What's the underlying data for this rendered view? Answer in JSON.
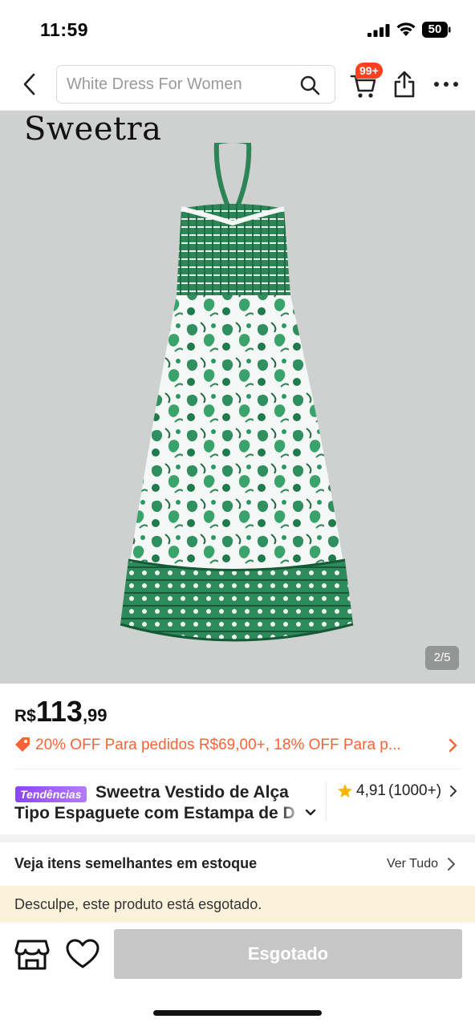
{
  "status_bar": {
    "time": "11:59",
    "battery": "50"
  },
  "nav": {
    "search_placeholder": "White Dress For Women",
    "cart_badge": "99+"
  },
  "hero": {
    "brand": "Sweetra",
    "pager": "2/5"
  },
  "price": {
    "currency": "R$",
    "integer": "113",
    "decimal": ",99"
  },
  "promo": {
    "text": "20% OFF Para pedidos R$69,00+,  18% OFF Para p..."
  },
  "product": {
    "trend_badge": "Tendências",
    "title_line1": "Sweetra Vestido de Alça",
    "title_line2": "Tipo Espaguete com Estampa de Desenho",
    "rating": "4,91",
    "rating_count": "(1000+)"
  },
  "similar": {
    "label": "Veja itens semelhantes em estoque",
    "link": "Ver Tudo"
  },
  "notice": "Desculpe, este produto está esgotado.",
  "bottom": {
    "button": "Esgotado"
  },
  "colors": {
    "accent": "#fa6338",
    "badge": "#fe3f20",
    "soldout_bg": "#fbf2dc",
    "disabled_button": "#c6c6c6"
  }
}
